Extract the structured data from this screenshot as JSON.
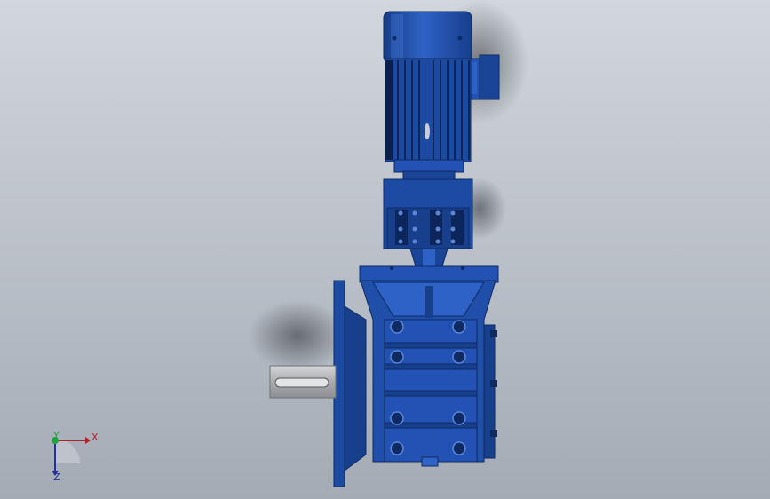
{
  "viewport": {
    "background_top": "#d2d6dd",
    "background_bottom": "#a4abb5"
  },
  "model": {
    "body_color": "#1f4fa8",
    "highlight_color": "#3a70d6",
    "shadow_color": "#123274",
    "shaft_color": "#b4b6b9"
  },
  "triad": {
    "x_label": "X",
    "y_label": "Y",
    "z_label": "Z",
    "x_color": "#b0222a",
    "y_color": "#23a33a",
    "z_color": "#23309a"
  }
}
